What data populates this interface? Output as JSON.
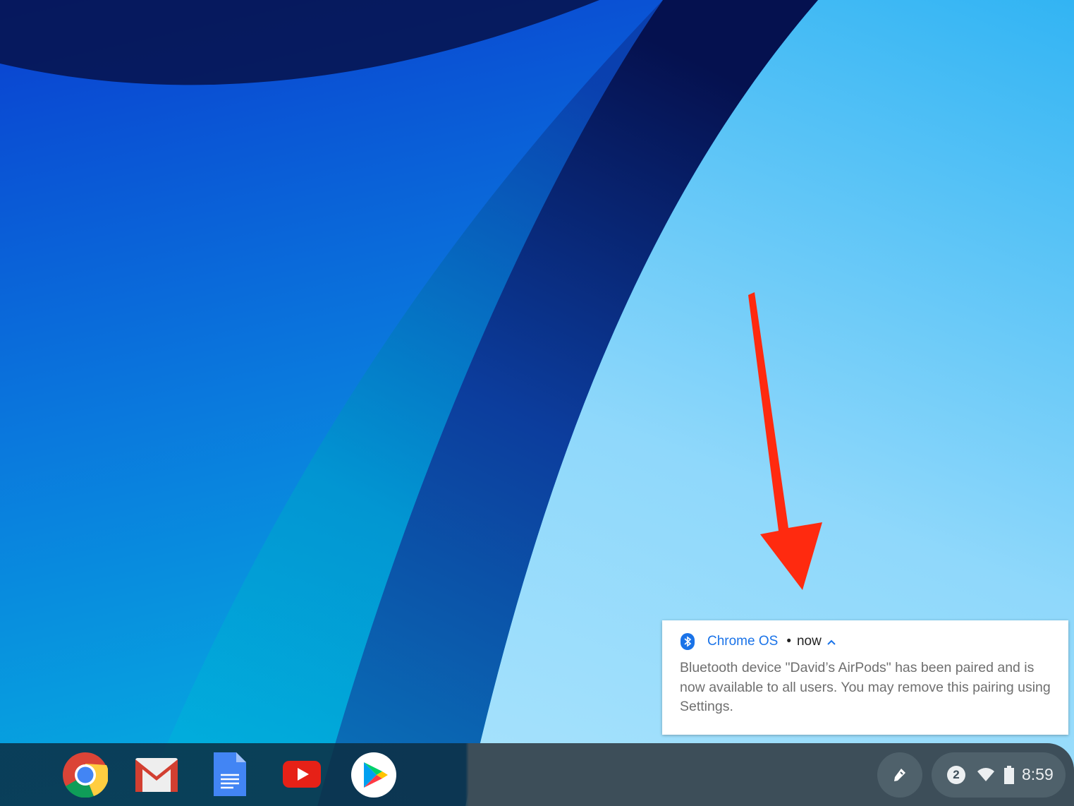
{
  "notification": {
    "app_name": "Chrome OS",
    "separator": "•",
    "time": "now",
    "expand_icon": "chevron-up-icon",
    "message": "Bluetooth device \"David’s AirPods\" has been paired and is now available to all users. You may remove this pairing using Settings."
  },
  "shelf": {
    "apps": [
      "Chrome",
      "Gmail",
      "Google Docs",
      "YouTube",
      "Play Store"
    ]
  },
  "status_area": {
    "notification_count": "2",
    "time": "8:59"
  },
  "colors": {
    "accent": "#1a73e8",
    "arrow": "#ff2a0f"
  }
}
